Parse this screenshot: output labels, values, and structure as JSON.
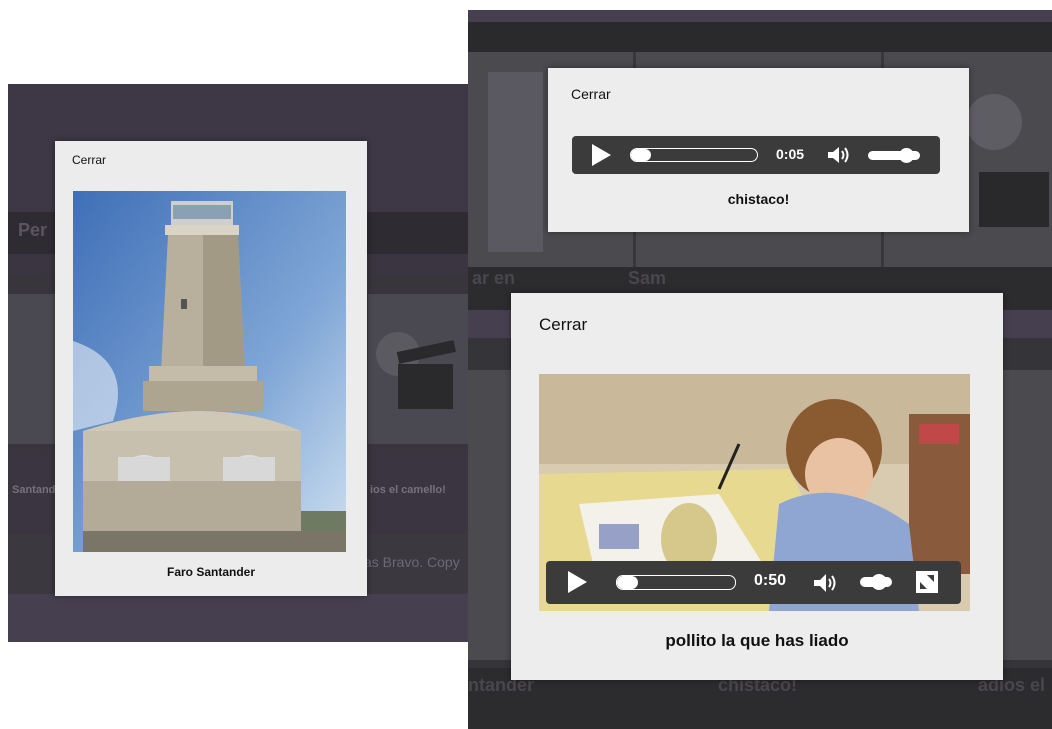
{
  "photo_modal": {
    "close_label": "Cerrar",
    "caption": "Faro Santander"
  },
  "audio_modal": {
    "close_label": "Cerrar",
    "time": "0:05",
    "progress": 0.12,
    "volume": 0.85,
    "caption": "chistaco!"
  },
  "video_modal": {
    "close_label": "Cerrar",
    "time": "0:50",
    "progress": 0.18,
    "volume": 0.7,
    "caption": "pollito la que has liado"
  },
  "background_left": {
    "nav_label": "Per",
    "thumb_caption_1": "Santand",
    "thumb_caption_2": "ios el camello!",
    "footer_text": "as Bravo. Copy"
  },
  "background_right": {
    "row1_caption_1": "ar en",
    "row1_caption_2": "Sam",
    "row2_caption_1": "ntander",
    "row2_caption_2": "chistaco!",
    "row2_caption_3": "adios el"
  },
  "colors": {
    "backdrop_purple": "#463f50",
    "modal_bg": "#ececec",
    "control_bar": "#3b3b3b"
  }
}
